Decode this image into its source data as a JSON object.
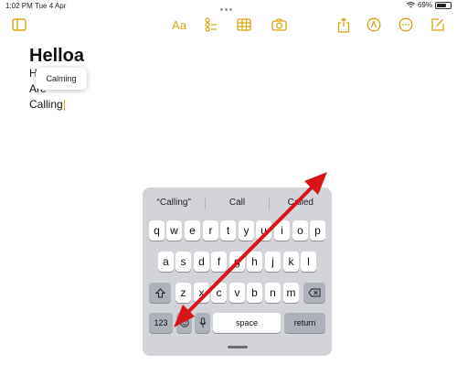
{
  "status": {
    "time": "1:02 PM",
    "date": "Tue 4 Apr",
    "battery_text": "69%",
    "battery_level": 0.69
  },
  "toolbar": {
    "format_label": "Aa",
    "accent_color": "#d9a40d",
    "icons": [
      "sidebar-icon",
      "checklist-icon",
      "table-icon",
      "camera-icon",
      "share-icon",
      "markup-icon",
      "more-icon",
      "compose-icon"
    ]
  },
  "note": {
    "title": "Helloa",
    "line1": "He",
    "line2": "Are yo",
    "line3": "Calling"
  },
  "popup": {
    "suggestion": "Calming"
  },
  "keyboard": {
    "predictions": [
      "“Calling”",
      "Call",
      "Called"
    ],
    "row1": [
      "q",
      "w",
      "e",
      "r",
      "t",
      "y",
      "u",
      "i",
      "o",
      "p"
    ],
    "row2": [
      "a",
      "s",
      "d",
      "f",
      "g",
      "h",
      "j",
      "k",
      "l"
    ],
    "row3": [
      "z",
      "x",
      "c",
      "v",
      "b",
      "n",
      "m"
    ],
    "numbers_label": "123",
    "space_label": "space",
    "return_label": "return"
  },
  "annotation": {
    "arrow_color": "#d9141b"
  }
}
